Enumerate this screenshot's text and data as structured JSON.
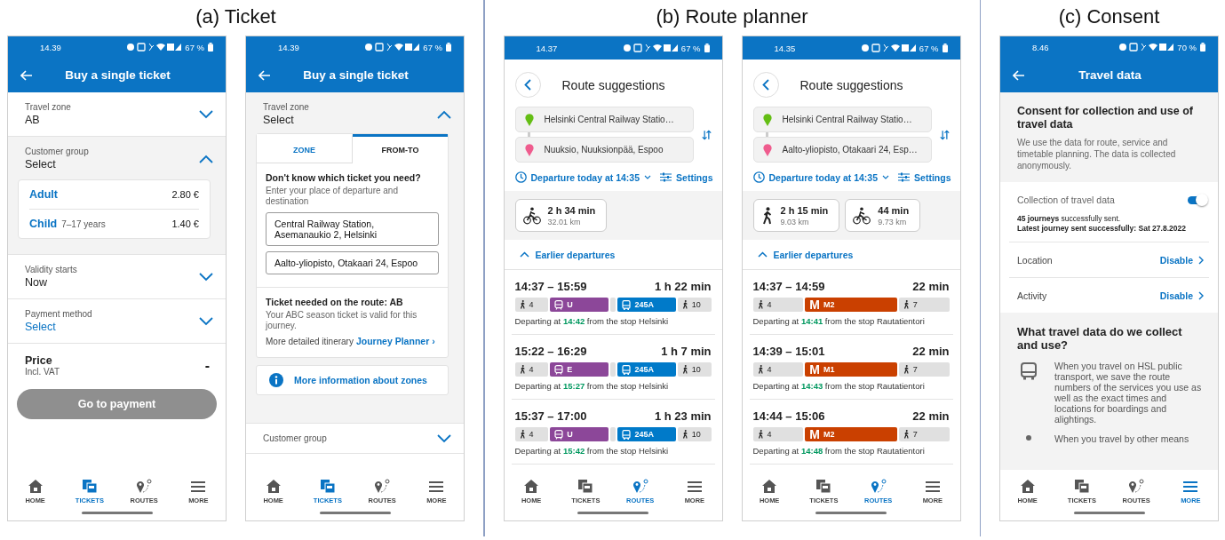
{
  "panels": [
    {
      "caption": "(a) Ticket",
      "phones": [
        {
          "kind": "ticket",
          "status": {
            "time": "14.39",
            "battery": "67 %"
          },
          "header": {
            "title": "Buy a single ticket"
          },
          "rows": [
            {
              "kind": "select",
              "label": "Travel zone",
              "value": "AB",
              "expanded": false
            },
            {
              "kind": "select",
              "label": "Customer group",
              "value": "Select",
              "expanded": true,
              "options": [
                {
                  "name": "Adult",
                  "price": "2.80 €"
                },
                {
                  "name": "Child",
                  "note": "7–17 years",
                  "price": "1.40 €"
                }
              ]
            },
            {
              "kind": "select",
              "label": "Validity starts",
              "value": "Now",
              "expanded": false
            },
            {
              "kind": "select",
              "label": "Payment method",
              "value": "Select",
              "accent": true,
              "expanded": false
            },
            {
              "kind": "price",
              "label": "Price",
              "note": "Incl. VAT",
              "value": "-"
            },
            {
              "kind": "button",
              "label": "Go to payment",
              "disabled": true
            }
          ],
          "nav": [
            {
              "kind": "home",
              "label": "HOME",
              "selected": false
            },
            {
              "kind": "tickets",
              "label": "TICKETS",
              "selected": true
            },
            {
              "kind": "routes",
              "label": "ROUTES",
              "selected": false
            },
            {
              "kind": "more",
              "label": "MORE",
              "selected": false
            }
          ]
        },
        {
          "kind": "ticket",
          "status": {
            "time": "14.39",
            "battery": "67 %"
          },
          "header": {
            "title": "Buy a single ticket"
          },
          "rows": [
            {
              "kind": "select",
              "label": "Travel zone",
              "value": "Select",
              "expanded": true,
              "finder": {
                "tabs": [
                  {
                    "label": "ZONE",
                    "selected": false
                  },
                  {
                    "label": "FROM-TO",
                    "selected": true
                  }
                ],
                "question": "Don't know which ticket you need?",
                "hint": "Enter your place of departure and destination",
                "fields": [
                  "Central Railway Station, Asemanaukio 2, Helsinki",
                  "Aalto-yliopisto, Otakaari 24, Espoo"
                ],
                "result_title": "Ticket needed on the route: AB",
                "result_text": "Your ABC season ticket is valid for this journey.",
                "itinerary": "More detailed itinerary",
                "itinerary_link": "Journey Planner ›",
                "info_link": "More information about zones"
              }
            },
            {
              "kind": "select",
              "label": "Customer group",
              "expanded": false
            }
          ],
          "nav": [
            {
              "kind": "home",
              "label": "HOME",
              "selected": false
            },
            {
              "kind": "tickets",
              "label": "TICKETS",
              "selected": true
            },
            {
              "kind": "routes",
              "label": "ROUTES",
              "selected": false
            },
            {
              "kind": "more",
              "label": "MORE",
              "selected": false
            }
          ]
        }
      ]
    },
    {
      "caption": "(b) Route planner",
      "phones": [
        {
          "kind": "routes",
          "status": {
            "time": "14.37",
            "battery": "67 %"
          },
          "title": "Route suggestions",
          "from": "Helsinki Central Railway Statio…",
          "to": "Nuuksio, Nuuksionpää, Espoo",
          "departure": "Departure today at 14:35",
          "settings": "Settings",
          "modes": [
            {
              "kind": "bike",
              "duration": "2 h 34 min",
              "distance": "32.01 km"
            }
          ],
          "earlier": "Earlier departures",
          "itineraries": [
            {
              "time": "14:37 – 15:59",
              "duration": "1 h 22 min",
              "legs": [
                {
                  "kind": "walk",
                  "label": "4"
                },
                {
                  "kind": "train",
                  "label": "U",
                  "color": "#8c4799"
                },
                {
                  "kind": "gap"
                },
                {
                  "kind": "bus",
                  "label": "245A",
                  "color": "#007ac9"
                },
                {
                  "kind": "walk",
                  "label": "10"
                }
              ],
              "departing": "Departing at **14:42** from the stop Helsinki"
            },
            {
              "time": "15:22 – 16:29",
              "duration": "1 h 7 min",
              "legs": [
                {
                  "kind": "walk",
                  "label": "4"
                },
                {
                  "kind": "train",
                  "label": "E",
                  "color": "#8c4799"
                },
                {
                  "kind": "gap"
                },
                {
                  "kind": "bus",
                  "label": "245A",
                  "color": "#007ac9"
                },
                {
                  "kind": "walk",
                  "label": "10"
                }
              ],
              "departing": "Departing at **15:27** from the stop Helsinki"
            },
            {
              "time": "15:37 – 17:00",
              "duration": "1 h 23 min",
              "legs": [
                {
                  "kind": "walk",
                  "label": "4"
                },
                {
                  "kind": "train",
                  "label": "U",
                  "color": "#8c4799"
                },
                {
                  "kind": "gap"
                },
                {
                  "kind": "bus",
                  "label": "245A",
                  "color": "#007ac9"
                },
                {
                  "kind": "walk",
                  "label": "10"
                }
              ],
              "departing": "Departing at **15:42** from the stop Helsinki"
            }
          ],
          "nav": [
            {
              "kind": "home",
              "label": "HOME",
              "selected": false
            },
            {
              "kind": "tickets",
              "label": "TICKETS",
              "selected": false
            },
            {
              "kind": "routes",
              "label": "ROUTES",
              "selected": true
            },
            {
              "kind": "more",
              "label": "MORE",
              "selected": false
            }
          ]
        },
        {
          "kind": "routes",
          "status": {
            "time": "14.35",
            "battery": "67 %"
          },
          "title": "Route suggestions",
          "from": "Helsinki Central Railway Statio…",
          "to": "Aalto-yliopisto, Otakaari 24, Esp…",
          "departure": "Departure today at 14:35",
          "settings": "Settings",
          "modes": [
            {
              "kind": "walk",
              "duration": "2 h 15 min",
              "distance": "9.03 km"
            },
            {
              "kind": "bike",
              "duration": "44 min",
              "distance": "9.73 km"
            }
          ],
          "earlier": "Earlier departures",
          "itineraries": [
            {
              "time": "14:37 – 14:59",
              "duration": "22 min",
              "legs": [
                {
                  "kind": "walk",
                  "label": "4"
                },
                {
                  "kind": "metro",
                  "logo": "M",
                  "label": "M2",
                  "color": "#ca4000"
                },
                {
                  "kind": "walk",
                  "label": "7"
                }
              ],
              "departing": "Departing at **14:41** from the stop Rautatientori"
            },
            {
              "time": "14:39 – 15:01",
              "duration": "22 min",
              "legs": [
                {
                  "kind": "walk",
                  "label": "4"
                },
                {
                  "kind": "metro",
                  "logo": "M",
                  "label": "M1",
                  "color": "#ca4000"
                },
                {
                  "kind": "walk",
                  "label": "7"
                }
              ],
              "departing": "Departing at **14:43** from the stop Rautatientori"
            },
            {
              "time": "14:44 – 15:06",
              "duration": "22 min",
              "legs": [
                {
                  "kind": "walk",
                  "label": "4"
                },
                {
                  "kind": "metro",
                  "logo": "M",
                  "label": "M2",
                  "color": "#ca4000"
                },
                {
                  "kind": "walk",
                  "label": "7"
                }
              ],
              "departing": "Departing at **14:48** from the stop Rautatientori"
            }
          ],
          "nav": [
            {
              "kind": "home",
              "label": "HOME",
              "selected": false
            },
            {
              "kind": "tickets",
              "label": "TICKETS",
              "selected": false
            },
            {
              "kind": "routes",
              "label": "ROUTES",
              "selected": true
            },
            {
              "kind": "more",
              "label": "MORE",
              "selected": false
            }
          ]
        }
      ]
    },
    {
      "caption": "(c) Consent",
      "phones": [
        {
          "kind": "consent",
          "status": {
            "time": "8.46",
            "battery": "70 %"
          },
          "header": {
            "title": "Travel data"
          },
          "intro": {
            "title": "Consent for collection and use of travel data",
            "text": "We use the data for route, service and timetable planning. The data is collected anonymously."
          },
          "toggle": {
            "label": "Collection of travel data",
            "on": true
          },
          "sent": "**45 journeys** successfully sent.",
          "latest": "Latest journey sent successfully: Sat 27.8.2022",
          "links": [
            {
              "label": "Location",
              "action": "Disable"
            },
            {
              "label": "Activity",
              "action": "Disable"
            }
          ],
          "info": {
            "title": "What travel data do we collect and use?",
            "items": [
              {
                "kind": "bus",
                "text": "When you travel on HSL public transport, we save the route numbers of the services you use as well as the exact times and locations for boardings and alightings."
              },
              {
                "kind": "dot",
                "text": "When you travel by other means"
              }
            ]
          },
          "nav": [
            {
              "kind": "home",
              "label": "HOME",
              "selected": false
            },
            {
              "kind": "tickets",
              "label": "TICKETS",
              "selected": false
            },
            {
              "kind": "routes",
              "label": "ROUTES",
              "selected": false
            },
            {
              "kind": "more",
              "label": "MORE",
              "selected": true
            }
          ]
        }
      ]
    }
  ]
}
